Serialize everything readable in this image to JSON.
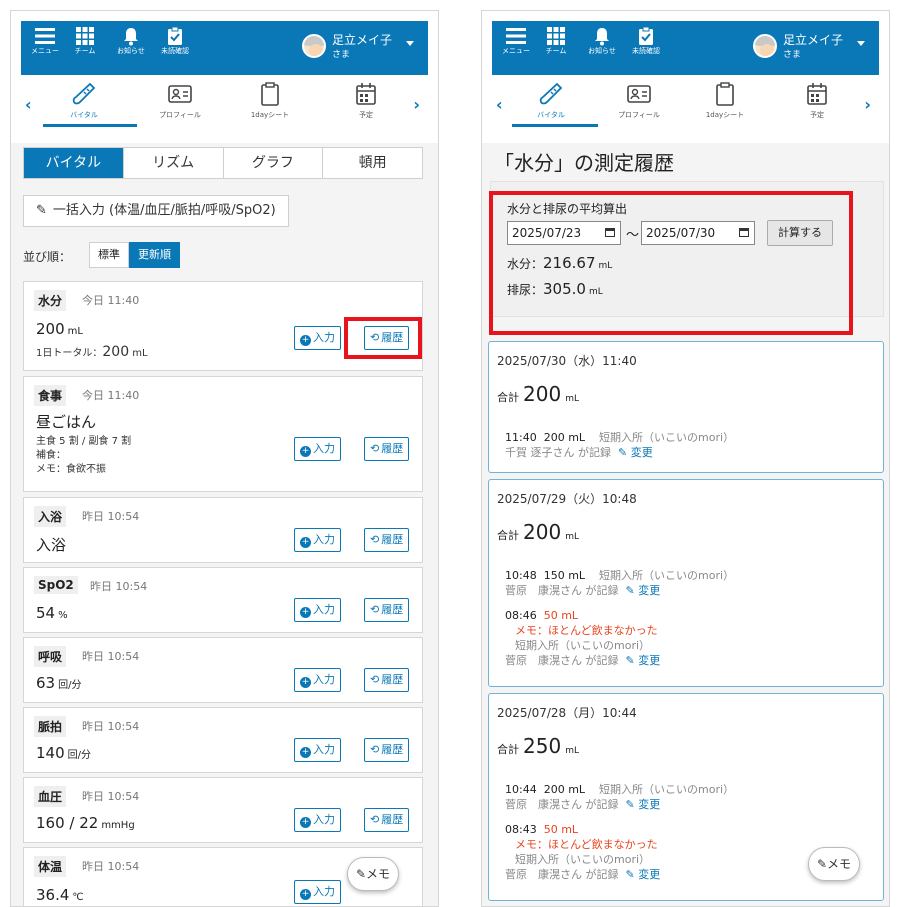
{
  "header": {
    "menu_label": "メニュー",
    "team_label": "チーム",
    "notify_label": "お知らせ",
    "unread_label": "未読確認",
    "user_name": "足立メイ子",
    "user_honorific": "さま"
  },
  "subnav": {
    "vital_label": "バイタル",
    "profile_label": "プロフィール",
    "oneday_label": "1dayシート",
    "schedule_label": "予定"
  },
  "left": {
    "tabs": [
      "バイタル",
      "リズム",
      "グラフ",
      "頓用"
    ],
    "bulk_input": "一括入力 (体温/血圧/脈拍/呼吸/SpO2)",
    "sort": {
      "label": "並び順：",
      "standard": "標準",
      "newest": "更新順"
    },
    "btn_input": "入力",
    "btn_history": "履歴",
    "cards": [
      {
        "name": "水分",
        "time": "今日 11:40",
        "value": "200",
        "unit": "mL",
        "sub_label": "1日トータル：",
        "sub_value": "200",
        "sub_unit": "mL"
      },
      {
        "name": "食事",
        "time": "今日 11:40",
        "value": "昼ごはん",
        "line1": "主食 5 割 / 副食 7 割",
        "line2": "補食：",
        "line3": "メモ：食欲不振"
      },
      {
        "name": "入浴",
        "time": "昨日 10:54",
        "value": "入浴"
      },
      {
        "name": "SpO2",
        "time": "昨日 10:54",
        "value": "54",
        "unit": "%"
      },
      {
        "name": "呼吸",
        "time": "昨日 10:54",
        "value": "63",
        "unit": "回/分"
      },
      {
        "name": "脈拍",
        "time": "昨日 10:54",
        "value": "140",
        "unit": "回/分"
      },
      {
        "name": "血圧",
        "time": "昨日 10:54",
        "value": "160 / 22",
        "unit": "mmHg"
      },
      {
        "name": "体温",
        "time": "昨日 10:54",
        "value": "36.4",
        "unit": "℃"
      }
    ],
    "memo_fab": "メモ"
  },
  "right": {
    "title": "「水分」の測定履歴",
    "avg": {
      "heading": "水分と排尿の平均算出",
      "date_from": "2025/07/23",
      "tilde": "〜",
      "date_to": "2025/07/30",
      "calc_button": "計算する",
      "water_label": "水分：",
      "water_value": "216.67",
      "water_unit": "mL",
      "urine_label": "排尿：",
      "urine_value": "305.0",
      "urine_unit": "mL"
    },
    "total_label": "合計",
    "unit": "mL",
    "change_label": "変更",
    "history": [
      {
        "date": "2025/07/30（水）11:40",
        "total": "200",
        "e1_time": "11:40",
        "e1_amount": "200 mL",
        "e1_place": "短期入所（いこいのmori）",
        "e1_by": "千賀 逐子さん が記録"
      },
      {
        "date": "2025/07/29（火）10:48",
        "total": "200",
        "e1_time": "10:48",
        "e1_amount": "150 mL",
        "e1_place": "短期入所（いこいのmori）",
        "e1_by": "菅原　康滉さん が記録",
        "e2_time": "08:46",
        "e2_amount": "50 mL",
        "e2_memo": "メモ：ほとんど飲まなかった",
        "e2_place": "短期入所（いこいのmori）",
        "e2_by": "菅原　康滉さん が記録"
      },
      {
        "date": "2025/07/28（月）10:44",
        "total": "250",
        "e1_time": "10:44",
        "e1_amount": "200 mL",
        "e1_place": "短期入所（いこいのmori）",
        "e1_by": "菅原　康滉さん が記録",
        "e2_time": "08:43",
        "e2_amount": "50 mL",
        "e2_memo": "メモ：ほとんど飲まなかった",
        "e2_place": "短期入所（いこいのmori）",
        "e2_by": "菅原　康滉さん が記録"
      }
    ],
    "memo_fab": "メモ"
  },
  "colors": {
    "brand": "#0a78b6",
    "highlight": "#e8141d",
    "memo_red": "#e8441e"
  }
}
